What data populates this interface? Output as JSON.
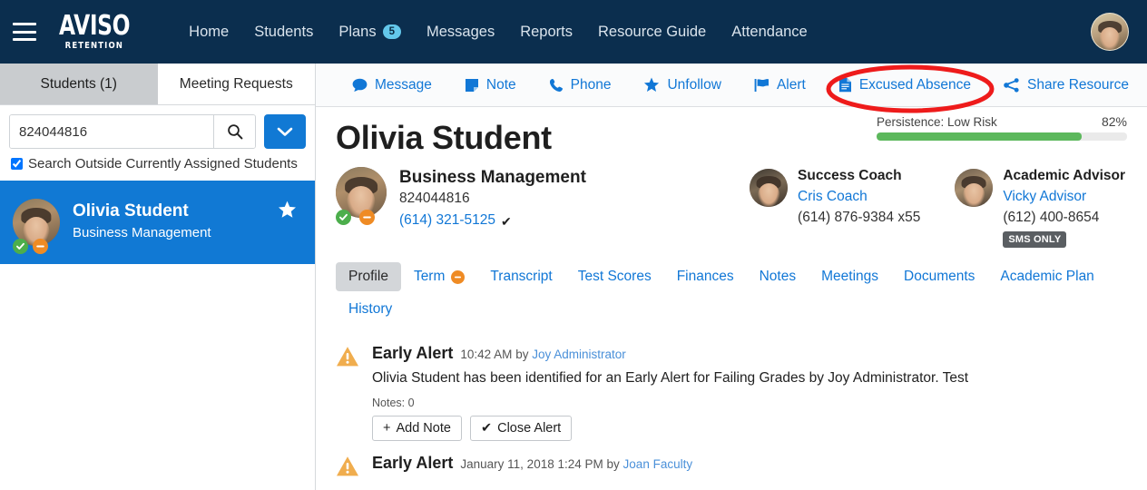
{
  "header": {
    "logo_main": "AVISO",
    "logo_sub": "RETENTION",
    "nav": [
      {
        "label": "Home",
        "badge": null
      },
      {
        "label": "Students",
        "badge": null
      },
      {
        "label": "Plans",
        "badge": "5"
      },
      {
        "label": "Messages",
        "badge": null
      },
      {
        "label": "Reports",
        "badge": null
      },
      {
        "label": "Resource Guide",
        "badge": null
      },
      {
        "label": "Attendance",
        "badge": null
      }
    ],
    "colors": {
      "background": "#0b2e4e",
      "link": "#d9e3ec",
      "badge_bg": "#63c7ea"
    }
  },
  "sidebar": {
    "tabs": [
      {
        "label": "Students (1)",
        "active": true
      },
      {
        "label": "Meeting Requests",
        "active": false
      }
    ],
    "search": {
      "value": "824044816",
      "placeholder": "Search",
      "search_icon": "search-icon",
      "dropdown_icon": "chevron-down-icon"
    },
    "search_outside": {
      "label": "Search Outside Currently Assigned Students",
      "checked": true
    },
    "student": {
      "name": "Olivia Student",
      "major": "Business Management",
      "followed": true,
      "star_icon": "star-icon",
      "status_icons": [
        "check-circle-icon",
        "minus-circle-icon"
      ]
    }
  },
  "action_bar": {
    "actions": [
      {
        "label": "Message",
        "icon": "chat-bubble-icon"
      },
      {
        "label": "Note",
        "icon": "note-icon"
      },
      {
        "label": "Phone",
        "icon": "phone-icon"
      },
      {
        "label": "Unfollow",
        "icon": "star-icon"
      },
      {
        "label": "Alert",
        "icon": "flag-icon"
      },
      {
        "label": "Excused Absence",
        "icon": "document-icon"
      },
      {
        "label": "Share Resource",
        "icon": "share-icon"
      }
    ],
    "highlighted_action": "Excused Absence",
    "highlight_color": "#ee1b1b"
  },
  "student": {
    "name": "Olivia Student",
    "major": "Business Management",
    "id": "824044816",
    "phone": "(614) 321-5125",
    "phone_verified_icon": "check-icon",
    "status_icons": [
      "check-circle-icon",
      "minus-circle-icon"
    ]
  },
  "staff": [
    {
      "role": "Success Coach",
      "name": "Cris Coach",
      "phone": "(614) 876-9384 x55",
      "badge": null
    },
    {
      "role": "Academic Advisor",
      "name": "Vicky Advisor",
      "phone": "(612) 400-8654",
      "badge": "SMS ONLY"
    }
  ],
  "persistence": {
    "label": "Persistence: Low Risk",
    "percent_label": "82%",
    "percent_value": 82,
    "bar_color": "#5cb85c"
  },
  "profile_tabs": [
    {
      "label": "Profile",
      "active": true,
      "dot": false
    },
    {
      "label": "Term",
      "active": false,
      "dot": true
    },
    {
      "label": "Transcript",
      "active": false,
      "dot": false
    },
    {
      "label": "Test Scores",
      "active": false,
      "dot": false
    },
    {
      "label": "Finances",
      "active": false,
      "dot": false
    },
    {
      "label": "Notes",
      "active": false,
      "dot": false
    },
    {
      "label": "Meetings",
      "active": false,
      "dot": false
    },
    {
      "label": "Documents",
      "active": false,
      "dot": false
    },
    {
      "label": "Academic Plan",
      "active": false,
      "dot": false
    },
    {
      "label": "History",
      "active": false,
      "dot": false
    }
  ],
  "alerts": [
    {
      "icon": "warning-triangle-icon",
      "title": "Early Alert",
      "time": "10:42 AM",
      "by_prefix": "by",
      "author": "Joy Administrator",
      "description": "Olivia Student has been identified for an Early Alert for Failing Grades by Joy Administrator. Test",
      "notes": "Notes: 0",
      "buttons": [
        {
          "label": "Add Note",
          "glyph": "+"
        },
        {
          "label": "Close Alert",
          "glyph": "✔"
        }
      ]
    },
    {
      "icon": "warning-triangle-icon",
      "title": "Early Alert",
      "time": "January 11, 2018 1:24 PM",
      "by_prefix": "by",
      "author": "Joan Faculty",
      "description": "",
      "notes": "",
      "buttons": []
    }
  ]
}
